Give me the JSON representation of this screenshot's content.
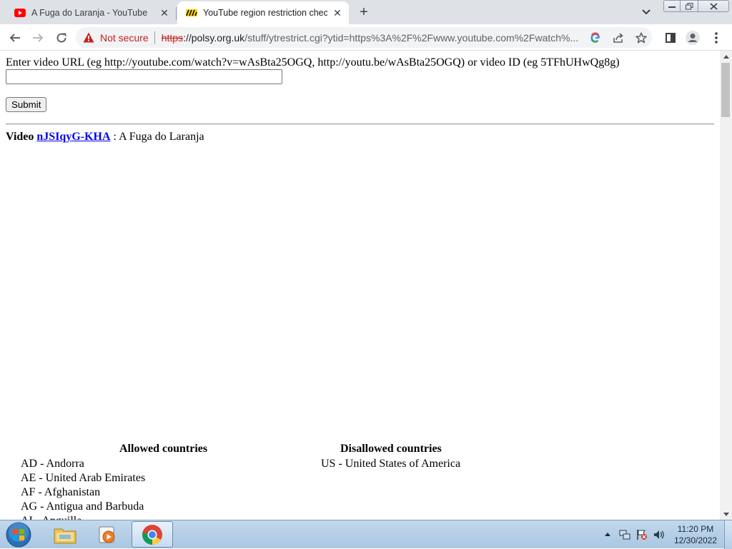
{
  "browser": {
    "tabs": [
      {
        "title": "A Fuga do Laranja - YouTube",
        "favicon": "youtube-icon",
        "active": false
      },
      {
        "title": "YouTube region restriction checker",
        "favicon": "site-favicon-icon",
        "active": true
      }
    ],
    "omnibox": {
      "security_label": "Not secure",
      "url_scheme": "https",
      "url_host": "://polsy.org.uk",
      "url_path": "/stuff/ytrestrict.cgi?ytid=https%3A%2F%2Fwww.youtube.com%2Fwatch%..."
    }
  },
  "page": {
    "prompt": "Enter video URL (eg http://youtube.com/watch?v=wAsBta25OGQ, http://youtu.be/wAsBta25OGQ) or video ID (eg 5TFhUHwQg8g)",
    "input_value": "",
    "submit_label": "Submit",
    "video_label": "Video",
    "video_id": "nJSIqyG-KHA",
    "video_title_separator": " : ",
    "video_title": "A Fuga do Laranja",
    "allowed_heading": "Allowed countries",
    "disallowed_heading": "Disallowed countries",
    "allowed_countries": [
      "AD - Andorra",
      "AE - United Arab Emirates",
      "AF - Afghanistan",
      "AG - Antigua and Barbuda",
      "AI - Anguilla"
    ],
    "disallowed_countries": [
      "US - United States of America"
    ]
  },
  "taskbar": {
    "items": [
      "start-orb-icon",
      "file-explorer-icon",
      "media-player-icon",
      "chrome-icon"
    ],
    "clock_time": "11:20 PM",
    "clock_date": "12/30/2022"
  },
  "colors": {
    "not_secure_red": "#c5221f",
    "link_blue": "#0000ee",
    "tab_strip": "#dee1e6",
    "taskbar_blue": "#a9c6e3"
  }
}
